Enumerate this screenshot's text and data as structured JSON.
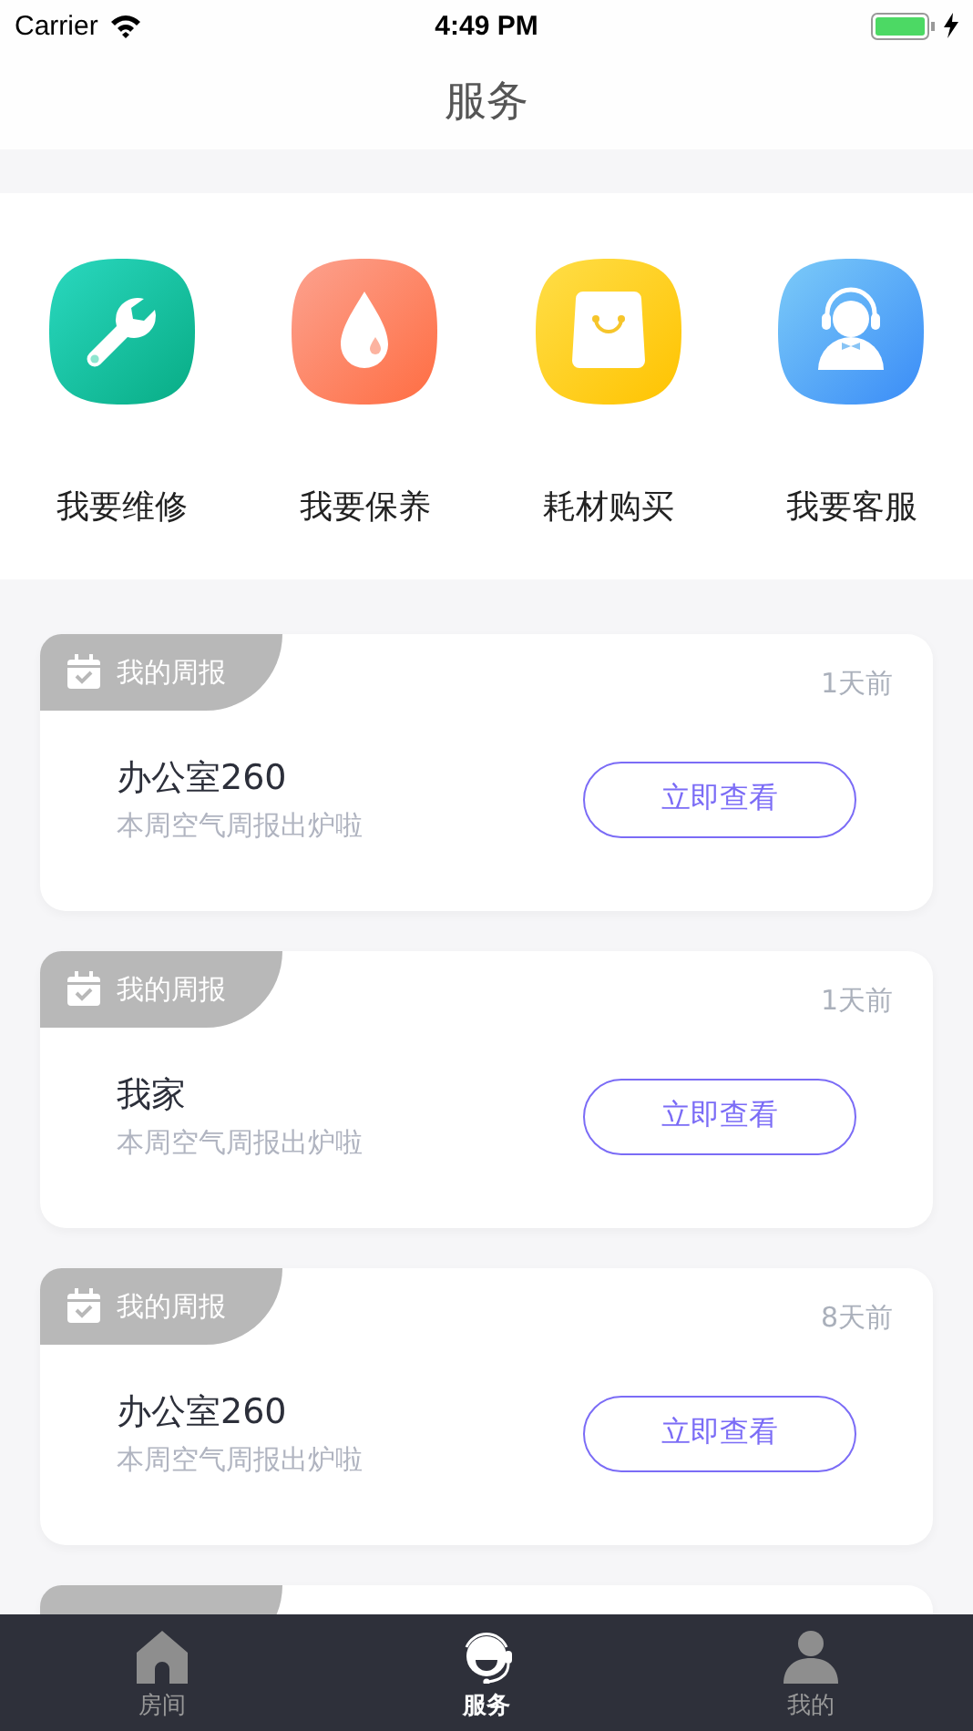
{
  "status_bar": {
    "carrier": "Carrier",
    "time": "4:49 PM",
    "battery": {
      "level": 1,
      "charging": true
    }
  },
  "nav": {
    "title": "服务"
  },
  "services": [
    {
      "kind": "repair",
      "label": "我要维修"
    },
    {
      "kind": "maintenance",
      "label": "我要保养"
    },
    {
      "kind": "supplies",
      "label": "耗材购买"
    },
    {
      "kind": "support",
      "label": "我要客服"
    }
  ],
  "reports": [
    {
      "tag": "我的周报",
      "time": "1天前",
      "title": "办公室260",
      "subtitle": "本周空气周报出炉啦",
      "button": "立即查看"
    },
    {
      "tag": "我的周报",
      "time": "1天前",
      "title": "我家",
      "subtitle": "本周空气周报出炉啦",
      "button": "立即查看"
    },
    {
      "tag": "我的周报",
      "time": "8天前",
      "title": "办公室260",
      "subtitle": "本周空气周报出炉啦",
      "button": "立即查看"
    }
  ],
  "more_reports_below": true,
  "tab_bar": [
    {
      "kind": "home",
      "label": "房间",
      "selected": false
    },
    {
      "kind": "service",
      "label": "服务",
      "selected": true
    },
    {
      "kind": "profile",
      "label": "我的",
      "selected": false
    }
  ]
}
